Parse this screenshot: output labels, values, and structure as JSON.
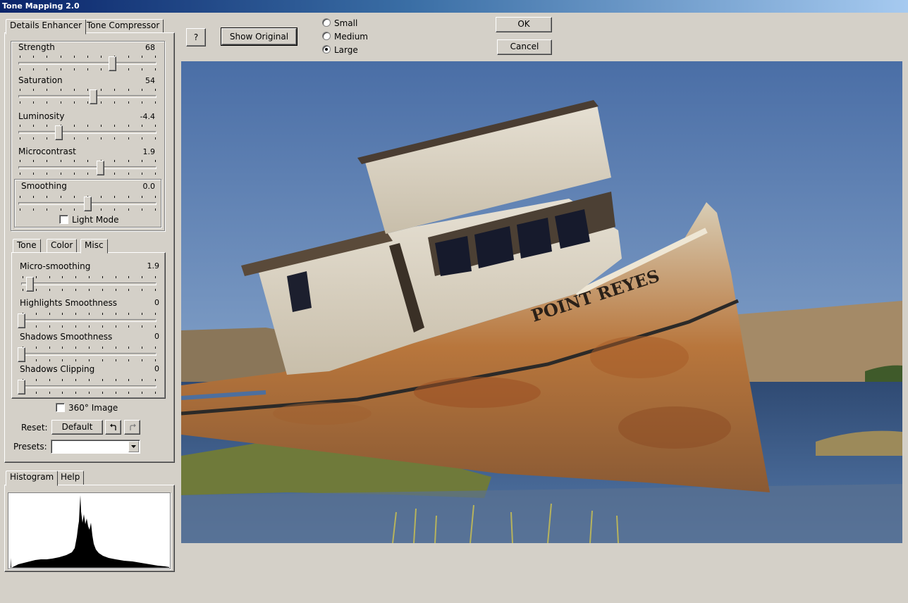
{
  "window": {
    "title": "Tone Mapping 2.0"
  },
  "top_tabs": [
    {
      "label": "Details Enhancer",
      "active": true
    },
    {
      "label": "Tone Compressor",
      "active": false
    }
  ],
  "sliders_main": [
    {
      "label": "Strength",
      "value": "68",
      "level": 0.68
    },
    {
      "label": "Saturation",
      "value": "54",
      "level": 0.54
    },
    {
      "label": "Luminosity",
      "value": "-4.4",
      "level": 0.29
    },
    {
      "label": "Microcontrast",
      "value": "1.9",
      "level": 0.59
    }
  ],
  "smoothing": {
    "label": "Smoothing",
    "value": "0.0",
    "level": 0.5,
    "light_mode_label": "Light Mode",
    "light_mode_checked": false
  },
  "sub_tabs": [
    {
      "label": "Tone",
      "active": false
    },
    {
      "label": "Color",
      "active": false
    },
    {
      "label": "Misc",
      "active": true
    }
  ],
  "sliders_misc": [
    {
      "label": "Micro-smoothing",
      "value": "1.9",
      "level": 0.06
    },
    {
      "label": "Highlights Smoothness",
      "value": "0",
      "level": 0.0
    },
    {
      "label": "Shadows Smoothness",
      "value": "0",
      "level": 0.0
    },
    {
      "label": "Shadows Clipping",
      "value": "0",
      "level": 0.0
    }
  ],
  "image360": {
    "label": "360° Image",
    "checked": false
  },
  "reset": {
    "label": "Reset:",
    "default_button": "Default",
    "undo_icon": "undo-icon",
    "redo_icon": "redo-icon"
  },
  "presets": {
    "label": "Presets:",
    "value": ""
  },
  "bottom_tabs": [
    {
      "label": "Histogram",
      "active": true
    },
    {
      "label": "Help",
      "active": false
    }
  ],
  "toolbar": {
    "help_button": "?",
    "show_original_button": "Show Original",
    "size_options": [
      {
        "label": "Small",
        "selected": false
      },
      {
        "label": "Medium",
        "selected": false
      },
      {
        "label": "Large",
        "selected": true
      }
    ],
    "ok_button": "OK",
    "cancel_button": "Cancel"
  },
  "preview": {
    "boat_name": "POINT REYES"
  },
  "colors": {
    "sky": "#4e73a8",
    "water": "#3e5c86",
    "rust": "#b56a2e",
    "hull": "#d9cdb6",
    "grass": "#6f7a3a",
    "hill": "#a48a67"
  }
}
